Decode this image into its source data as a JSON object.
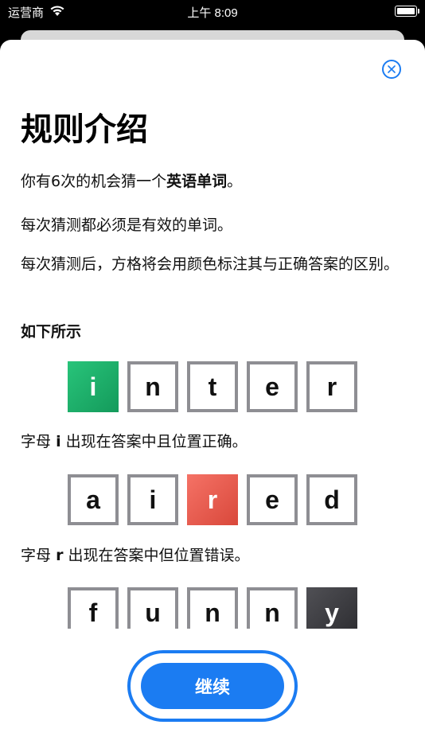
{
  "status_bar": {
    "carrier": "运营商",
    "time": "上午 8:09"
  },
  "sheet": {
    "title": "规则介绍",
    "para1_prefix": "你有6次的机会猜一个",
    "para1_bold": "英语单词",
    "para1_suffix": "。",
    "para2": "每次猜测都必须是有效的单词。",
    "para3": "每次猜测后，方格将会用颜色标注其与正确答案的区别。",
    "subhead": "如下所示",
    "example1": {
      "letters": [
        "i",
        "n",
        "t",
        "e",
        "r"
      ],
      "highlight_index": 0,
      "state": "correct",
      "caption_prefix": "字母",
      "caption_letter": "i",
      "caption_suffix": "出现在答案中且位置正确。"
    },
    "example2": {
      "letters": [
        "a",
        "i",
        "r",
        "e",
        "d"
      ],
      "highlight_index": 2,
      "state": "present",
      "caption_prefix": "字母",
      "caption_letter": "r",
      "caption_suffix": "出现在答案中但位置错误。"
    },
    "example3": {
      "letters": [
        "f",
        "u",
        "n",
        "n",
        "y"
      ],
      "highlight_index": 4,
      "state": "absent"
    },
    "continue_label": "继续"
  },
  "colors": {
    "accent": "#1b7cf2",
    "correct": "#1fb06a",
    "present": "#e85a4d",
    "absent": "#3a3a3e",
    "tile_border": "#8e8e93"
  }
}
